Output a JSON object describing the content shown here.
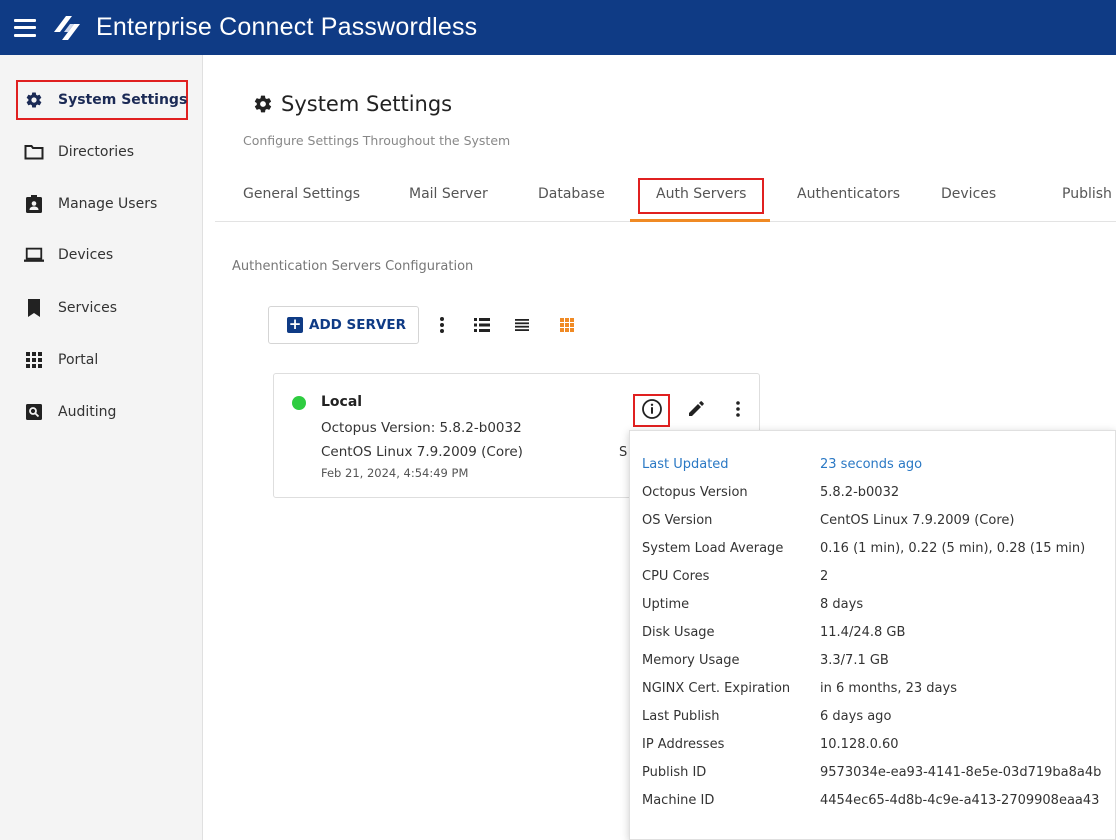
{
  "app": {
    "title": "Enterprise Connect Passwordless"
  },
  "sidebar": {
    "items": [
      {
        "label": "System Settings",
        "icon": "gear-icon",
        "active": true
      },
      {
        "label": "Directories",
        "icon": "folder-icon"
      },
      {
        "label": "Manage Users",
        "icon": "badge-icon"
      },
      {
        "label": "Devices",
        "icon": "laptop-icon"
      },
      {
        "label": "Services",
        "icon": "bookmark-icon"
      },
      {
        "label": "Portal",
        "icon": "grid-icon"
      },
      {
        "label": "Auditing",
        "icon": "search-box-icon"
      }
    ]
  },
  "page": {
    "title": "System Settings",
    "subtitle": "Configure Settings Throughout the System"
  },
  "tabs": [
    {
      "label": "General Settings"
    },
    {
      "label": "Mail Server"
    },
    {
      "label": "Database"
    },
    {
      "label": "Auth Servers",
      "active": true
    },
    {
      "label": "Authenticators"
    },
    {
      "label": "Devices"
    },
    {
      "label": "Publish"
    }
  ],
  "section": {
    "label": "Authentication Servers Configuration"
  },
  "toolbar": {
    "add_server_label": "ADD SERVER"
  },
  "server": {
    "name": "Local",
    "status": "online",
    "version_line": "Octopus Version: 5.8.2-b0032",
    "os_line": "CentOS Linux 7.9.2009 (Core)",
    "date_line": "Feb 21, 2024, 4:54:49 PM",
    "peek_char": "S"
  },
  "info_popup": {
    "rows": [
      {
        "key": "Last Updated",
        "value": "23 seconds ago"
      },
      {
        "key": "Octopus Version",
        "value": "5.8.2-b0032"
      },
      {
        "key": "OS Version",
        "value": "CentOS Linux 7.9.2009 (Core)"
      },
      {
        "key": "System Load Average",
        "value": "0.16 (1 min), 0.22 (5 min), 0.28 (15 min)"
      },
      {
        "key": "CPU Cores",
        "value": "2"
      },
      {
        "key": "Uptime",
        "value": "8 days"
      },
      {
        "key": "Disk Usage",
        "value": "11.4/24.8 GB"
      },
      {
        "key": "Memory Usage",
        "value": "3.3/7.1 GB"
      },
      {
        "key": "NGINX Cert. Expiration",
        "value": "in 6 months, 23 days"
      },
      {
        "key": "Last Publish",
        "value": "6 days ago"
      },
      {
        "key": "IP Addresses",
        "value": "10.128.0.60"
      },
      {
        "key": "Publish ID",
        "value": "9573034e-ea93-4141-8e5e-03d719ba8a4b"
      },
      {
        "key": "Machine ID",
        "value": "4454ec65-4d8b-4c9e-a413-2709908eaa43"
      }
    ]
  },
  "colors": {
    "header_bg": "#0f3b85",
    "accent_orange": "#f08a24",
    "highlight_red": "#e02020",
    "status_green": "#2ecc40",
    "link_blue": "#2a78c4"
  }
}
